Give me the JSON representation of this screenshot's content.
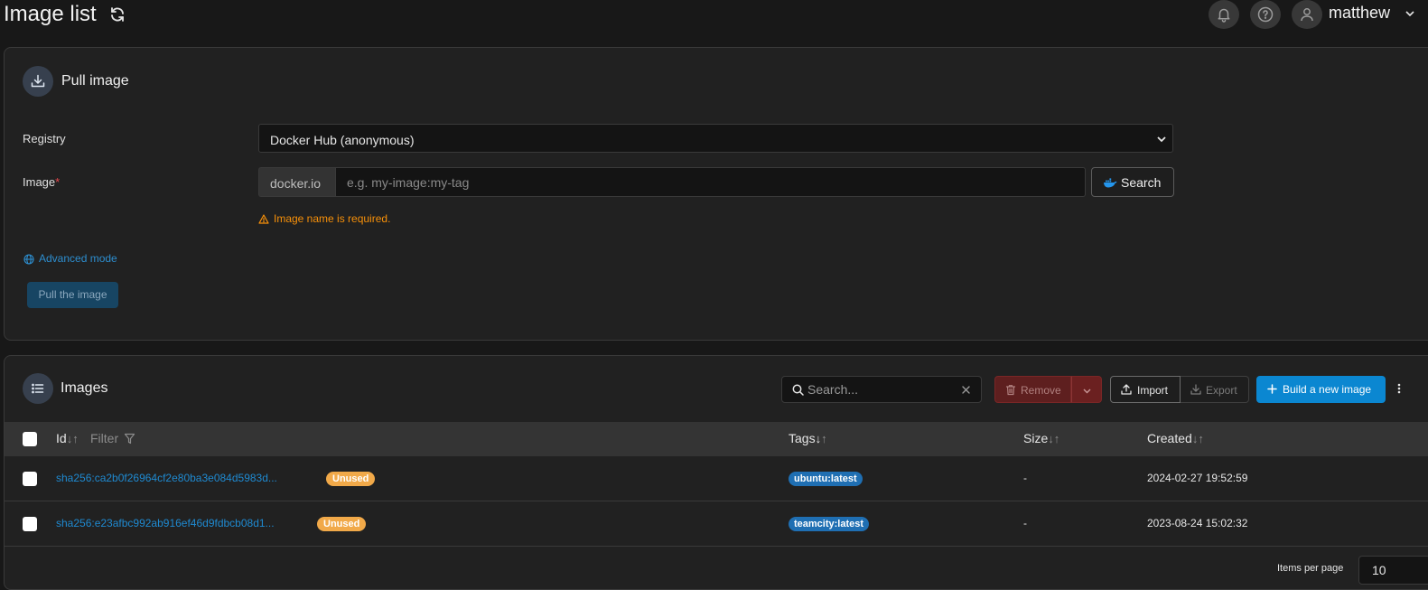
{
  "header": {
    "title": "Image list",
    "username": "matthew"
  },
  "pull_image": {
    "title": "Pull image",
    "registry_label": "Registry",
    "registry_value": "Docker Hub (anonymous)",
    "image_label": "Image",
    "image_required_mark": "*",
    "image_prefix": "docker.io",
    "image_value": "",
    "image_placeholder": "e.g. my-image:my-tag",
    "search_button": "Search",
    "validation_error": "Image name is required.",
    "advanced_mode": "Advanced mode",
    "pull_button": "Pull the image"
  },
  "images": {
    "title": "Images",
    "search_placeholder": "Search...",
    "remove_button": "Remove",
    "import_button": "Import",
    "export_button": "Export",
    "build_button": "Build a new image",
    "columns": {
      "id": "Id",
      "filter": "Filter",
      "tags": "Tags",
      "size": "Size",
      "created": "Created"
    },
    "rows": [
      {
        "id": "sha256:ca2b0f26964cf2e80ba3e084d5983d...",
        "status": "Unused",
        "tag": "ubuntu:latest",
        "size": "-",
        "created": "2024-02-27 19:52:59"
      },
      {
        "id": "sha256:e23afbc992ab916ef46d9fdbcb08d1...",
        "status": "Unused",
        "tag": "teamcity:latest",
        "size": "-",
        "created": "2023-08-24 15:02:32"
      }
    ],
    "items_per_page_label": "Items per page",
    "items_per_page_value": "10"
  },
  "colors": {
    "accent": "#0b87d1",
    "link": "#1f8ad1",
    "warning": "#f79009",
    "danger": "#7a2626",
    "unused_badge": "#f1a949",
    "tag_badge": "#1f6fb3"
  },
  "icons": [
    "refresh-icon",
    "bell-icon",
    "help-icon",
    "user-icon",
    "chevron-down-icon",
    "download-icon",
    "docker-whale-icon",
    "warning-icon",
    "globe-icon",
    "list-icon",
    "search-icon",
    "close-icon",
    "trash-icon",
    "upload-icon",
    "plus-icon",
    "kebab-icon",
    "filter-icon"
  ]
}
